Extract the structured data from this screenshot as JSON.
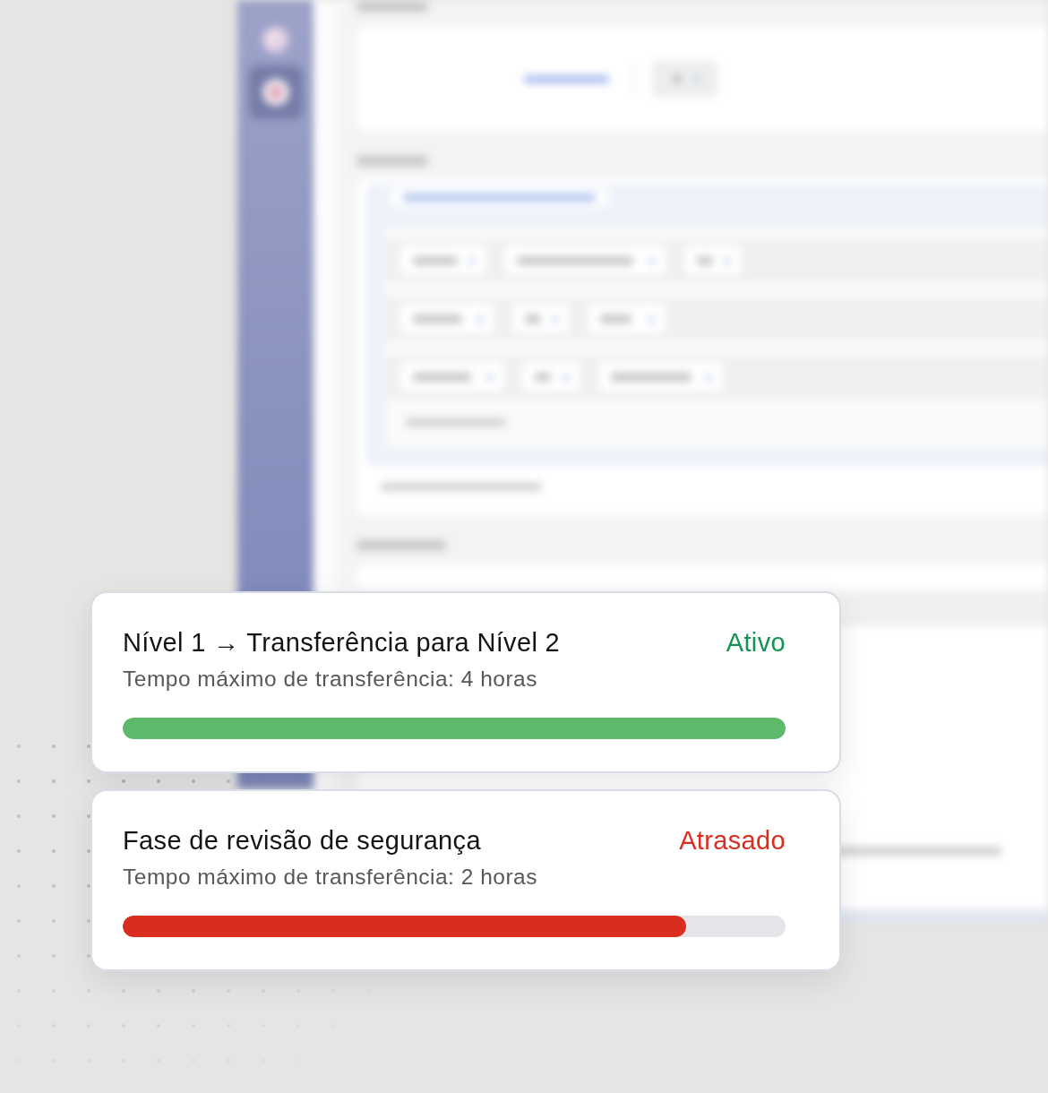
{
  "cards": [
    {
      "title": "Nível 1 → Transferência para Nível 2",
      "status": "Ativo",
      "kind": "on_track",
      "subtitle": "Tempo máximo de transferência: 4 horas",
      "level": 1
    },
    {
      "title": "Fase de revisão de segurança",
      "status": "Atrasado",
      "kind": "delayed",
      "subtitle": "Tempo máximo de transferência: 2 horas",
      "level": 0.85
    }
  ]
}
